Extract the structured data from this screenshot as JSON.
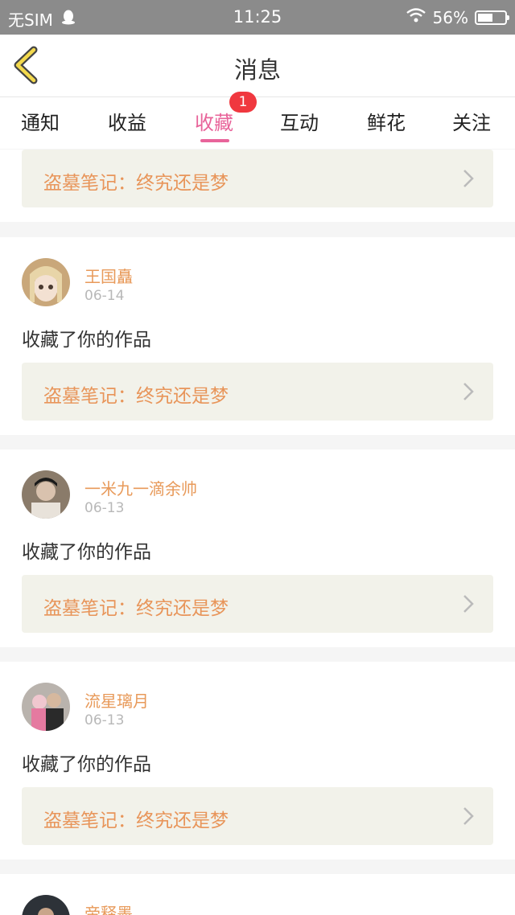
{
  "status_bar": {
    "carrier": "无SIM",
    "time": "11:25",
    "battery": "56%",
    "battery_level": 0.56
  },
  "header": {
    "title": "消息"
  },
  "tabs": [
    {
      "label": "通知"
    },
    {
      "label": "收益"
    },
    {
      "label": "收藏",
      "active": true,
      "badge": "1"
    },
    {
      "label": "互动"
    },
    {
      "label": "鲜花"
    },
    {
      "label": "关注"
    }
  ],
  "colors": {
    "accent": "#e8649a",
    "badge": "#f0383f",
    "orange": "#e8955a"
  },
  "first_link": {
    "title": "盗墓笔记：终究还是梦"
  },
  "items": [
    {
      "user": "王国矗",
      "date": "06-14",
      "message": "收藏了你的作品",
      "work": "盗墓笔记：终究还是梦"
    },
    {
      "user": "一米九一滴余帅",
      "date": "06-13",
      "message": "收藏了你的作品",
      "work": "盗墓笔记：终究还是梦"
    },
    {
      "user": "流星璃月",
      "date": "06-13",
      "message": "收藏了你的作品",
      "work": "盗墓笔记：终究还是梦"
    },
    {
      "user": "帝释墨"
    }
  ]
}
